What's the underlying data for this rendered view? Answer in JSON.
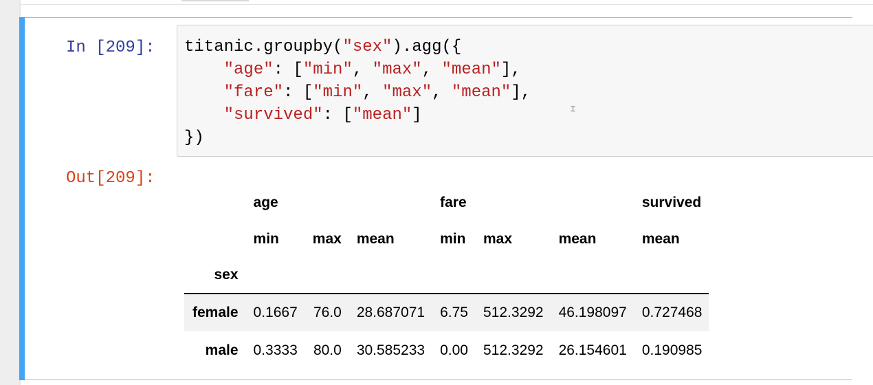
{
  "cell": {
    "in_prompt": "In [209]:",
    "out_prompt": "Out[209]:",
    "code_lines": [
      [
        {
          "t": "titanic.groupby(",
          "c": "plain"
        },
        {
          "t": "\"sex\"",
          "c": "str"
        },
        {
          "t": ").agg({",
          "c": "plain"
        }
      ],
      [
        {
          "t": "    ",
          "c": "plain"
        },
        {
          "t": "\"age\"",
          "c": "str"
        },
        {
          "t": ": [",
          "c": "plain"
        },
        {
          "t": "\"min\"",
          "c": "str"
        },
        {
          "t": ", ",
          "c": "plain"
        },
        {
          "t": "\"max\"",
          "c": "str"
        },
        {
          "t": ", ",
          "c": "plain"
        },
        {
          "t": "\"mean\"",
          "c": "str"
        },
        {
          "t": "],",
          "c": "plain"
        }
      ],
      [
        {
          "t": "    ",
          "c": "plain"
        },
        {
          "t": "\"fare\"",
          "c": "str"
        },
        {
          "t": ": [",
          "c": "plain"
        },
        {
          "t": "\"min\"",
          "c": "str"
        },
        {
          "t": ", ",
          "c": "plain"
        },
        {
          "t": "\"max\"",
          "c": "str"
        },
        {
          "t": ", ",
          "c": "plain"
        },
        {
          "t": "\"mean\"",
          "c": "str"
        },
        {
          "t": "],",
          "c": "plain"
        }
      ],
      [
        {
          "t": "    ",
          "c": "plain"
        },
        {
          "t": "\"survived\"",
          "c": "str"
        },
        {
          "t": ": [",
          "c": "plain"
        },
        {
          "t": "\"mean\"",
          "c": "str"
        },
        {
          "t": "]",
          "c": "plain"
        }
      ],
      [
        {
          "t": "})",
          "c": "plain"
        }
      ]
    ]
  },
  "output": {
    "header_groups": [
      {
        "label": "age",
        "span": 3
      },
      {
        "label": "fare",
        "span": 3
      },
      {
        "label": "survived",
        "span": 1
      }
    ],
    "header_stats": [
      "min",
      "max",
      "mean",
      "min",
      "max",
      "mean",
      "mean"
    ],
    "index_name": "sex",
    "rows": [
      {
        "index": "female",
        "values": [
          "0.1667",
          "76.0",
          "28.687071",
          "6.75",
          "512.3292",
          "46.198097",
          "0.727468"
        ]
      },
      {
        "index": "male",
        "values": [
          "0.3333",
          "80.0",
          "30.585233",
          "0.00",
          "512.3292",
          "26.154601",
          "0.190985"
        ]
      }
    ]
  },
  "colors": {
    "cell_bar": "#42a5f5",
    "in_prompt": "#303f9f",
    "out_prompt": "#d84315",
    "string": "#ba2121",
    "input_background": "#f7f7f7"
  }
}
